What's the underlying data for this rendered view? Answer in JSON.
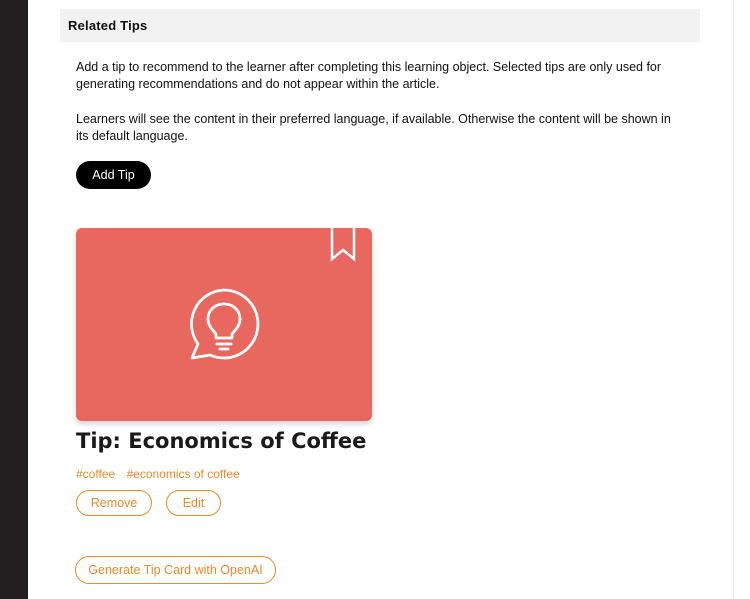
{
  "section": {
    "title": "Related Tips",
    "description_1": "Add a tip to recommend to the learner after completing this learning object. Selected tips are only used for generating recommendations and do not appear within the article.",
    "description_2": "Learners will see the content in their preferred language, if available. Otherwise the content will be shown in its default language.",
    "add_tip_label": "Add Tip"
  },
  "tip": {
    "title": "Tip: Economics of Coffee",
    "tags": [
      "#coffee",
      "#economics of coffee"
    ],
    "card_color": "#e8675e",
    "icon": "lightbulb-chat-icon",
    "remove_label": "Remove",
    "edit_label": "Edit"
  },
  "generate_label": "Generate Tip Card with OpenAI",
  "colors": {
    "accent": "#e88a2e",
    "primary_button": "#000000",
    "header_bg": "#f2f2f2"
  }
}
